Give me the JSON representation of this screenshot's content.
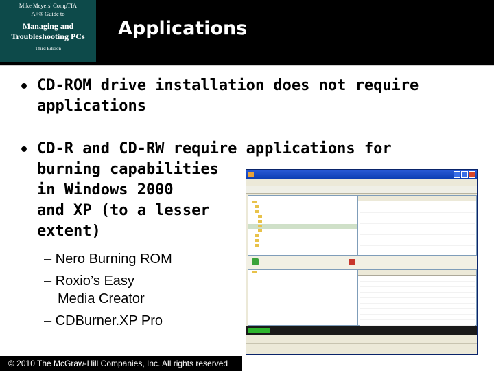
{
  "header": {
    "badge_line1": "Mike Meyers' CompTIA",
    "badge_line2": "A+® Guide to",
    "badge_line3": "Managing and",
    "badge_line4": "Troubleshooting PCs",
    "badge_edition": "Third Edition",
    "title": "Applications"
  },
  "bullets": [
    {
      "lines": [
        "CD-ROM drive installation does not require",
        "applications"
      ]
    },
    {
      "lines": [
        "CD-R and CD-RW require applications for",
        "burning capabilities",
        "in Windows 2000",
        "and XP (to a lesser",
        "extent)"
      ]
    }
  ],
  "subbullets": [
    {
      "lines": [
        "– Nero Burning ROM"
      ]
    },
    {
      "lines": [
        "– Roxio’s Easy",
        "Media Creator"
      ]
    },
    {
      "lines": [
        "– CDBurner.XP Pro"
      ]
    }
  ],
  "footer": {
    "text": "© 2010 The McGraw-Hill Companies, Inc. All rights reserved"
  },
  "colors": {
    "header_bg": "#000000",
    "badge_bg": "#0d4a4a",
    "xp_titlebar": "#0a3cb0",
    "progress_green": "#2db52d"
  }
}
